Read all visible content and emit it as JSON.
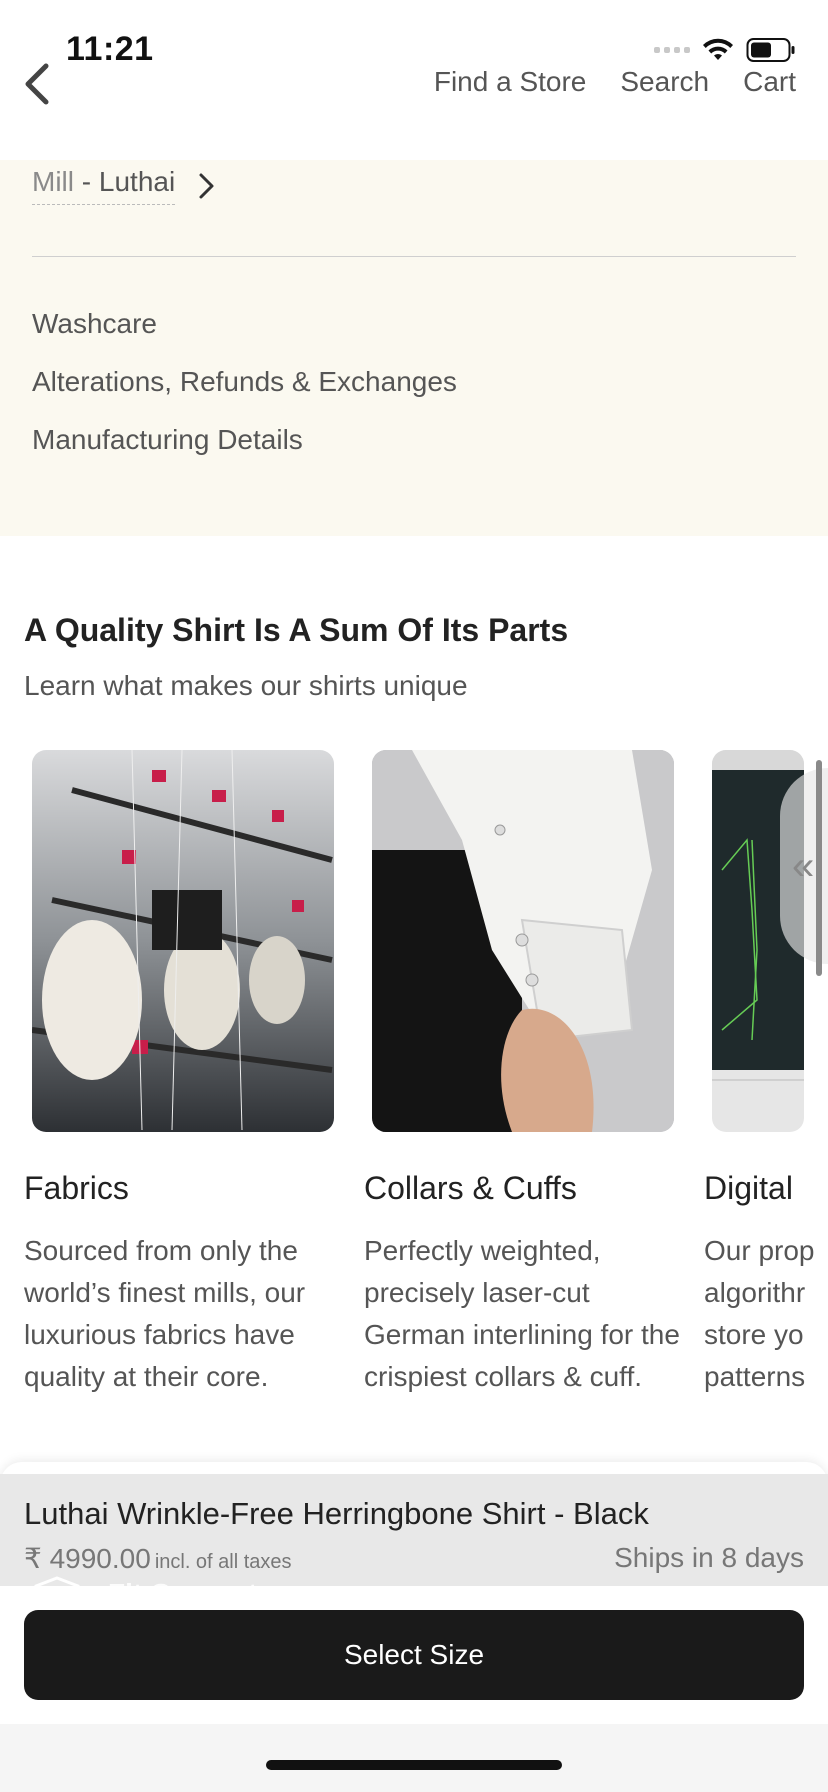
{
  "status_bar": {
    "time": "11:21"
  },
  "header": {
    "nav": [
      "Find a Store",
      "Search",
      "Cart"
    ]
  },
  "info": {
    "mill_prefix": "Mill",
    "mill_separator": " - ",
    "mill_name": "Luthai",
    "links": [
      "Washcare",
      "Alterations, Refunds & Exchanges",
      "Manufacturing Details"
    ]
  },
  "quality": {
    "title": "A Quality Shirt Is A Sum Of Its Parts",
    "subtitle": "Learn what makes our shirts unique",
    "cards": [
      {
        "title": "Fabrics",
        "description": "Sourced from only the world’s finest mills, our luxurious fabrics have quality at their core."
      },
      {
        "title": "Collars & Cuffs",
        "description": "Perfectly weighted, precisely laser-cut German interlining for the crispiest collars & cuff."
      },
      {
        "title": "Digital",
        "description": "Our prop algorithr store yo patterns"
      }
    ]
  },
  "product": {
    "name": "Luthai Wrinkle-Free Herringbone Shirt - Black",
    "price": "₹ 4990.00",
    "tax_note": "incl. of all taxes",
    "shipping": "Ships in 8 days",
    "hidden_label": "Fit Guarantee",
    "cta": "Select Size"
  },
  "colors": {
    "cream_bg": "#fbf9f0",
    "cta_bg": "#1a1a1a",
    "product_bar_bg": "#e8e8e8"
  }
}
